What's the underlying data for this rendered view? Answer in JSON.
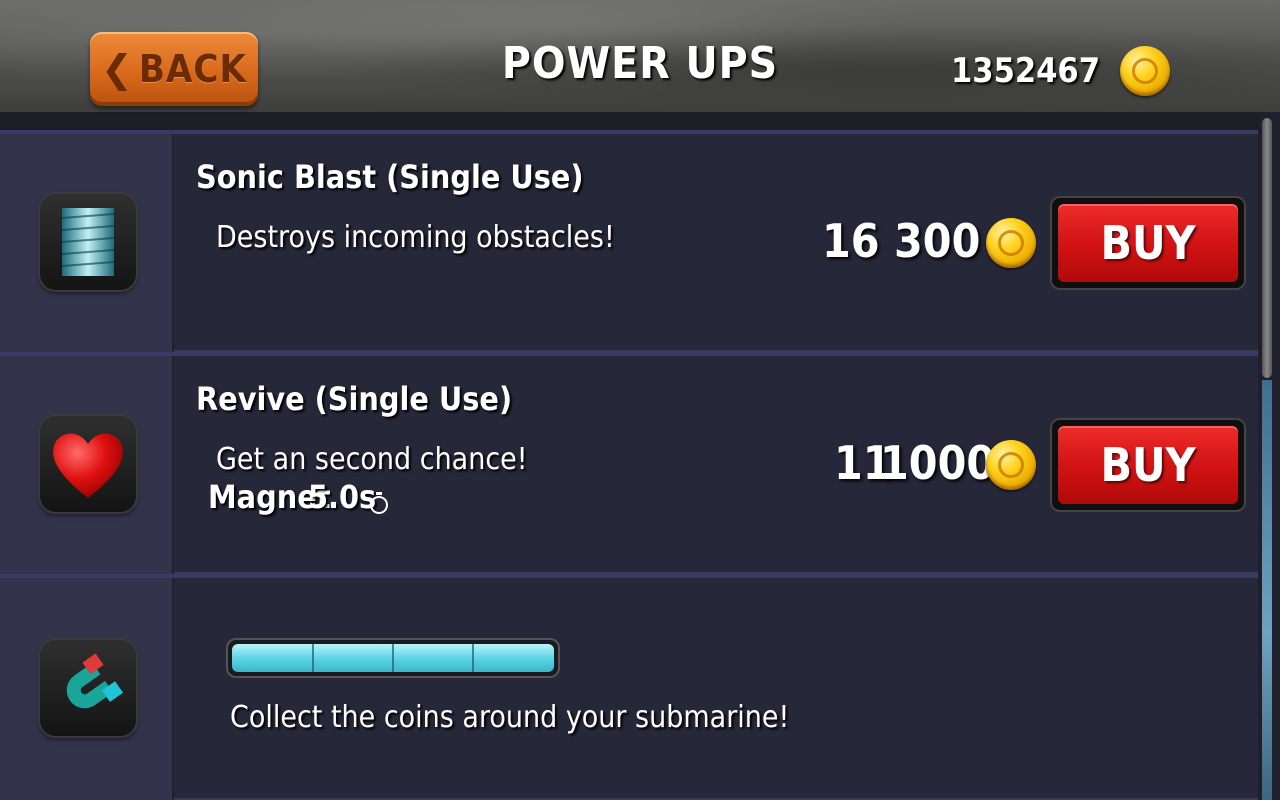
{
  "header": {
    "back_label": "BACK",
    "title": "POWER UPS",
    "coin_balance": "1352467"
  },
  "items": [
    {
      "name": "Sonic Blast (Single Use)",
      "description": "Destroys incoming obstacles!",
      "quantity": "16",
      "price": "300",
      "buy_label": "BUY",
      "icon": "sonic-blast-icon"
    },
    {
      "name": "Revive (Single Use)",
      "description": "Get an second chance!",
      "quantity": "11",
      "price": "1000",
      "buy_label": "BUY",
      "icon": "heart-icon"
    },
    {
      "name": "Magnet",
      "duration": "5.0s",
      "description": "Collect the coins around your submarine!",
      "icon": "magnet-icon",
      "upgrade_level": 4,
      "upgrade_max": 4
    }
  ],
  "colors": {
    "buy_button": "#d01212",
    "back_button": "#d96a1c",
    "progress": "#5ed6e6",
    "coin": "#ffd21e"
  }
}
